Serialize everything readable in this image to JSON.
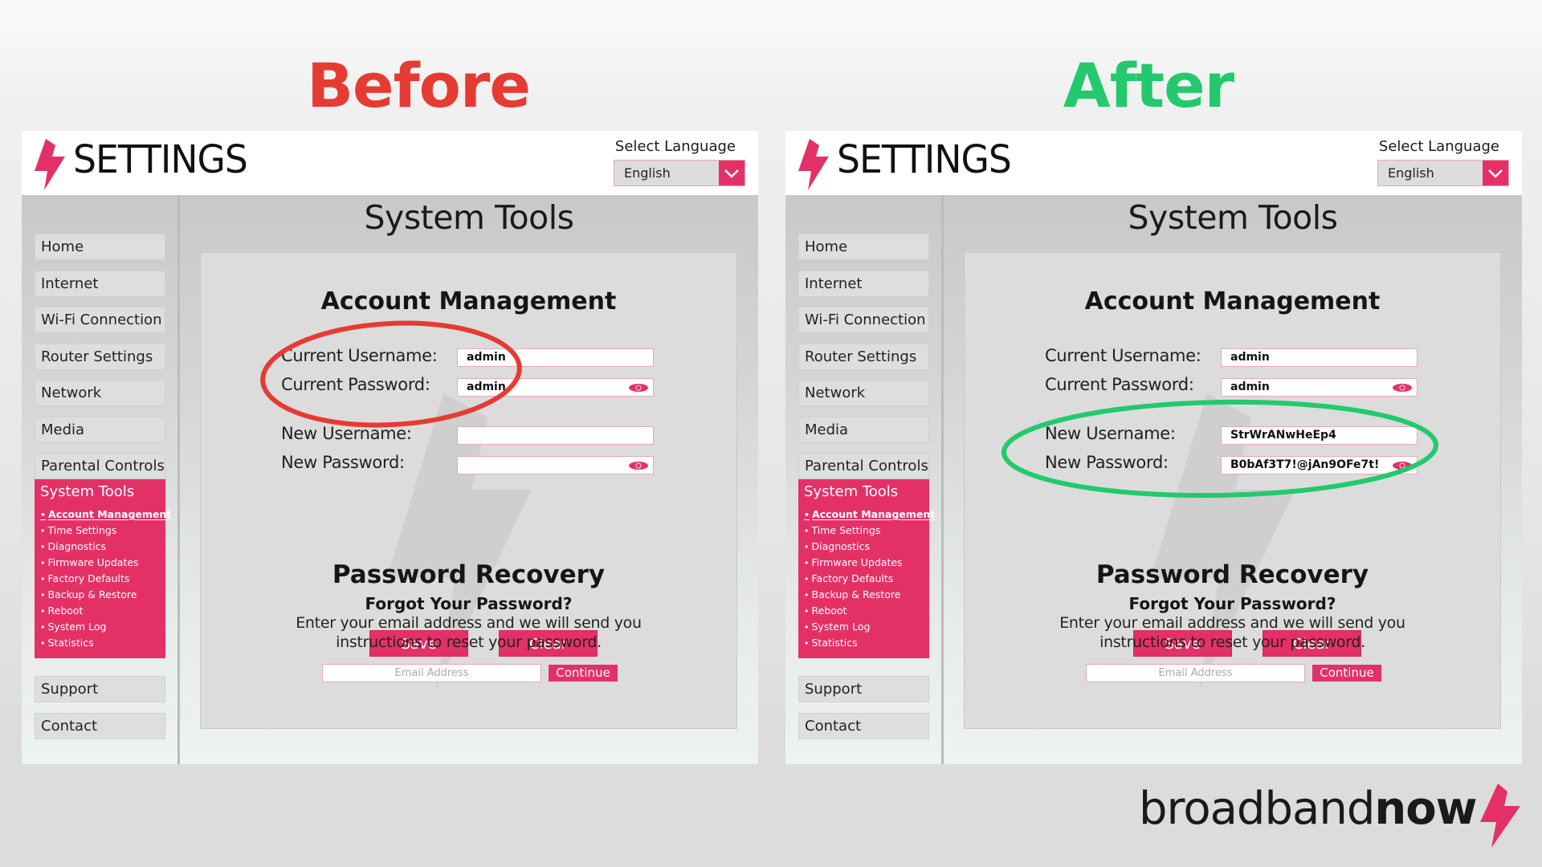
{
  "headings": {
    "before": "Before",
    "after": "After"
  },
  "colors": {
    "accent": "#e33168",
    "before": "#e53b32",
    "after": "#23c96c"
  },
  "panels": [
    {
      "id": "before",
      "header": {
        "title": "SETTINGS",
        "language_label": "Select Language",
        "language_value": "English"
      },
      "sidebar": {
        "items_top": [
          "Home",
          "Internet",
          "Wi-Fi Connection",
          "Router Settings",
          "Network",
          "Media",
          "Parental Controls"
        ],
        "group": {
          "title": "System Tools",
          "items": [
            "Account Management",
            "Time Settings",
            "Diagnostics",
            "Firmware Updates",
            "Factory Defaults",
            "Backup & Restore",
            "Reboot",
            "System Log",
            "Statistics"
          ],
          "active": "Account Management"
        },
        "items_bottom": [
          "Support",
          "Contact"
        ]
      },
      "main": {
        "title": "System Tools",
        "account": {
          "title": "Account Management",
          "current_username_label": "Current Username:",
          "current_username_value": "admin",
          "current_password_label": "Current Password:",
          "current_password_value": "admin",
          "new_username_label": "New Username:",
          "new_username_value": "",
          "new_password_label": "New Password:",
          "new_password_value": "",
          "save_label": "Save",
          "clear_label": "Clear"
        },
        "recovery": {
          "title": "Password Recovery",
          "subtitle": "Forgot Your Password?",
          "desc_line1": "Enter your email address and we will send you",
          "desc_line2": "instructions to reset your password.",
          "email_placeholder": "Email Address",
          "continue_label": "Continue"
        }
      },
      "highlight": "current credentials"
    },
    {
      "id": "after",
      "header": {
        "title": "SETTINGS",
        "language_label": "Select Language",
        "language_value": "English"
      },
      "sidebar": {
        "items_top": [
          "Home",
          "Internet",
          "Wi-Fi Connection",
          "Router Settings",
          "Network",
          "Media",
          "Parental Controls"
        ],
        "group": {
          "title": "System Tools",
          "items": [
            "Account Management",
            "Time Settings",
            "Diagnostics",
            "Firmware Updates",
            "Factory Defaults",
            "Backup & Restore",
            "Reboot",
            "System Log",
            "Statistics"
          ],
          "active": "Account Management"
        },
        "items_bottom": [
          "Support",
          "Contact"
        ]
      },
      "main": {
        "title": "System Tools",
        "account": {
          "title": "Account Management",
          "current_username_label": "Current Username:",
          "current_username_value": "admin",
          "current_password_label": "Current Password:",
          "current_password_value": "admin",
          "new_username_label": "New Username:",
          "new_username_value": "StrWrANwHeEp4",
          "new_password_label": "New Password:",
          "new_password_value": "B0bAf3T7!@jAn9OFe7t!",
          "save_label": "Save",
          "clear_label": "Clear"
        },
        "recovery": {
          "title": "Password Recovery",
          "subtitle": "Forgot Your Password?",
          "desc_line1": "Enter your email address and we will send you",
          "desc_line2": "instructions to reset your password.",
          "email_placeholder": "Email Address",
          "continue_label": "Continue"
        }
      },
      "highlight": "new credentials"
    }
  ],
  "brand": {
    "light": "broadband",
    "bold": "now"
  }
}
